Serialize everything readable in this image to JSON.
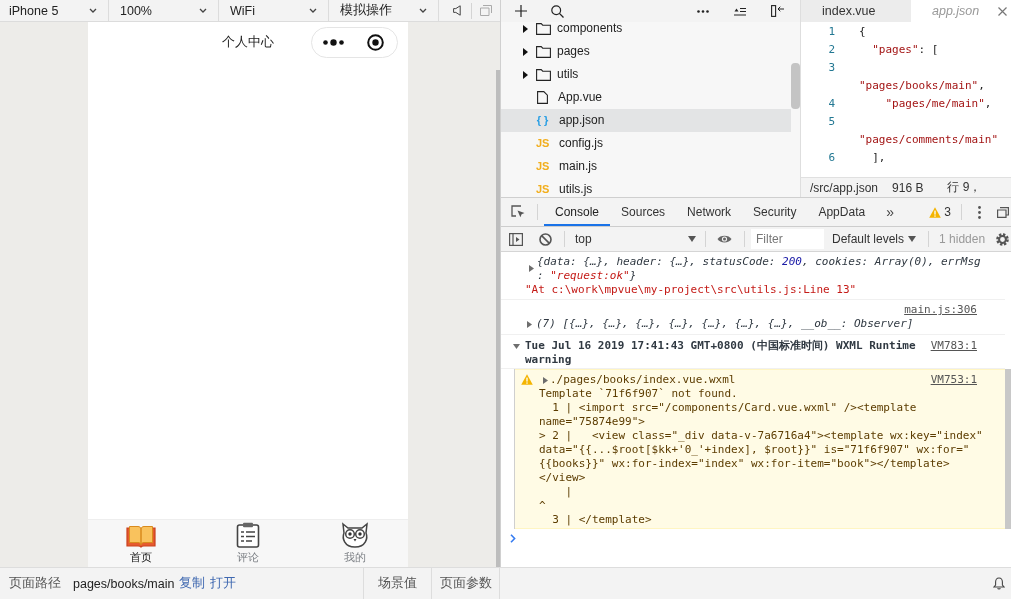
{
  "simulator_toolbar": {
    "dropdowns": [
      {
        "label": "iPhone 5"
      },
      {
        "label": "100%"
      },
      {
        "label": "WiFi"
      },
      {
        "label": "模拟操作"
      }
    ]
  },
  "phone": {
    "title": "个人中心",
    "tabs": [
      {
        "label": "首页",
        "selected": true
      },
      {
        "label": "评论",
        "selected": false
      },
      {
        "label": "我的",
        "selected": false
      }
    ]
  },
  "file_tree": {
    "items": [
      {
        "name": "components",
        "kind": "folder",
        "expanded": false,
        "selected": false
      },
      {
        "name": "pages",
        "kind": "folder",
        "expanded": false,
        "selected": false
      },
      {
        "name": "utils",
        "kind": "folder",
        "expanded": false,
        "selected": false
      },
      {
        "name": "App.vue",
        "kind": "file",
        "selected": false
      },
      {
        "name": "app.json",
        "kind": "typed_file",
        "type_mark": "{ }",
        "color": "#2a9fe4",
        "selected": true
      },
      {
        "name": "config.js",
        "kind": "typed_file",
        "type_mark": "JS",
        "color": "#f2ae1c",
        "selected": false
      },
      {
        "name": "main.js",
        "kind": "typed_file",
        "type_mark": "JS",
        "color": "#f2ae1c",
        "selected": false
      },
      {
        "name": "utils.js",
        "kind": "typed_file",
        "type_mark": "JS",
        "color": "#f2ae1c",
        "selected": false
      }
    ]
  },
  "editor": {
    "tabs": [
      {
        "label": "index.vue",
        "selected": false,
        "preview": false
      },
      {
        "label": "app.json",
        "selected": true,
        "preview": true
      }
    ],
    "lines": [
      {
        "number": "1",
        "text": "{"
      },
      {
        "number": "2",
        "text": "  \"pages\": ["
      },
      {
        "number": "3",
        "text": "    \"pages/books/main\","
      },
      {
        "number": "4",
        "text": "    \"pages/me/main\","
      },
      {
        "number": "5",
        "text": "    \"pages/comments/main\""
      },
      {
        "number": "6",
        "text": "  ],"
      }
    ],
    "status": {
      "path": "/src/app.json",
      "size": "916 B",
      "cursor": "行 9，"
    }
  },
  "devtools": {
    "tabs": [
      {
        "label": "Console",
        "selected": true
      },
      {
        "label": "Sources",
        "selected": false
      },
      {
        "label": "Network",
        "selected": false
      },
      {
        "label": "Security",
        "selected": false
      },
      {
        "label": "AppData",
        "selected": false
      }
    ],
    "more_tabs": "»",
    "warning_count": "3"
  },
  "console": {
    "context": "top",
    "filter": {
      "placeholder": "Filter"
    },
    "levels": "Default levels",
    "hidden": "1 hidden",
    "messages": [
      {
        "kind": "object_log",
        "expanded": false,
        "parts": [
          {
            "kind": "plain",
            "text": "{data: {…}, header: {…}, statusCode: "
          },
          {
            "kind": "number",
            "text": "200"
          },
          {
            "kind": "plain",
            "text": ", cookies: Array(0), errMsg\n: "
          },
          {
            "kind": "string",
            "text": "\"request:ok\""
          },
          {
            "kind": "plain",
            "text": "}"
          }
        ],
        "extra": "\"At c:\\work\\mpvue\\my-project\\src\\utils.js:Line 13\""
      },
      {
        "kind": "array_log",
        "expanded": false,
        "source": "main.js:306",
        "text": "(7) [{…}, {…}, {…}, {…}, {…}, {…}, {…}, __ob__: Observer]"
      },
      {
        "kind": "group",
        "expanded": true,
        "source": "VM783:1",
        "text": "Tue Jul 16 2019 17:41:43 GMT+0800 (中国标准时间) WXML Runtime\nwarning",
        "children": [
          {
            "kind": "warning",
            "expanded": false,
            "source": "VM753:1",
            "title": "./pages/books/index.vue.wxml",
            "body": "Template `71f6f907` not found.\n  1 | <import src=\"/components/Card.vue.wxml\" /><template\nname=\"75874e99\">\n> 2 |   <view class=\"_div data-v-7a6716a4\"><template wx:key=\"index\"\ndata=\"{{...$root[$kk+'0_'+index], $root}}\" is=\"71f6f907\" wx:for=\"\n{{books}}\" wx:for-index=\"index\" wx:for-item=\"book\"></template>\n</view>\n    |\n^\n  3 | </template>"
          }
        ]
      }
    ]
  },
  "status_bar": {
    "path_label": "页面路径",
    "path": "pages/books/main",
    "actions": [
      {
        "label": "复制"
      },
      {
        "label": "打开"
      }
    ],
    "buttons": [
      {
        "label": "场景值"
      },
      {
        "label": "页面参数"
      }
    ]
  }
}
